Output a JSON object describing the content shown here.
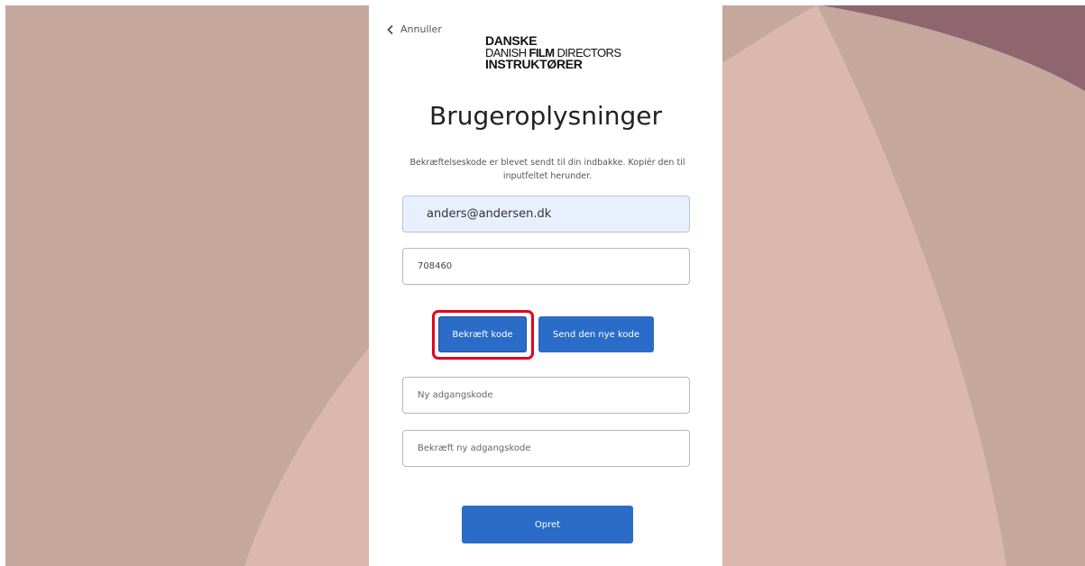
{
  "colors": {
    "background_base": "#c5a79c",
    "background_light": "#dbb8ae",
    "background_dark": "#8f6670",
    "card": "#ffffff",
    "primary_button": "#2b6cc8",
    "email_autofill": "#e8f0fe",
    "highlight": "#e3001b"
  },
  "nav": {
    "cancel_label": "Annuller",
    "cancel_icon": "chevron-left-icon"
  },
  "logo": {
    "line1": "DANSKE",
    "line2_prefix": "DANISH ",
    "line2_bold": "FILM",
    "line2_suffix": " DIRECTORS",
    "line3": "INSTRUKTØRER"
  },
  "page": {
    "title": "Brugeroplysninger",
    "info": "Bekræftelseskode er blevet sendt til din indbakke. Kopiér den til inputfeltet herunder."
  },
  "form": {
    "email_value": "anders@andersen.dk",
    "code_value": "708460",
    "new_password_placeholder": "Ny adgangskode",
    "confirm_password_placeholder": "Bekræft ny adgangskode"
  },
  "buttons": {
    "verify_label": "Bekræft kode",
    "resend_label": "Send den nye kode",
    "create_label": "Opret"
  }
}
